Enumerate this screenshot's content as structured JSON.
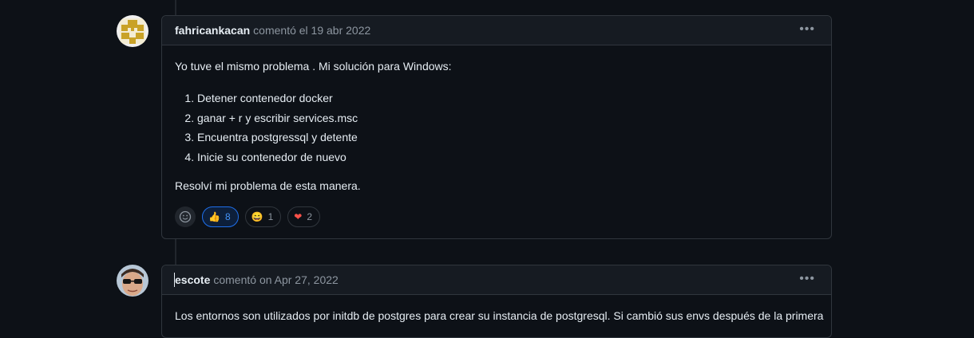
{
  "comments": [
    {
      "author": "fahricankacan",
      "meta": "comentó el 19 abr 2022",
      "intro": "Yo tuve el mismo problema . Mi solución para Windows:",
      "steps": [
        "Detener contenedor docker",
        "ganar + r y escribir services.msc",
        "Encuentra postgressql y detente",
        "Inicie su contenedor de nuevo"
      ],
      "outro": "Resolví mi problema de esta manera.",
      "reactions": [
        {
          "icon": "thumbs-up-icon",
          "glyph": "👍",
          "count": "8",
          "active": true
        },
        {
          "icon": "laugh-icon",
          "glyph": "😄",
          "count": "1",
          "active": false
        },
        {
          "icon": "heart-icon",
          "glyph": "❤",
          "count": "2",
          "active": false
        }
      ]
    },
    {
      "author": "escote",
      "meta": "comentó on Apr 27, 2022",
      "body": "Los entornos son utilizados por initdb de postgres para crear su instancia de postgresql. Si cambió sus envs después de la primera"
    }
  ],
  "menu_glyph": "•••",
  "colors": {
    "accent": "#4493f8",
    "border": "#30363d",
    "header_bg": "#161b22",
    "bg": "#0d1117"
  }
}
